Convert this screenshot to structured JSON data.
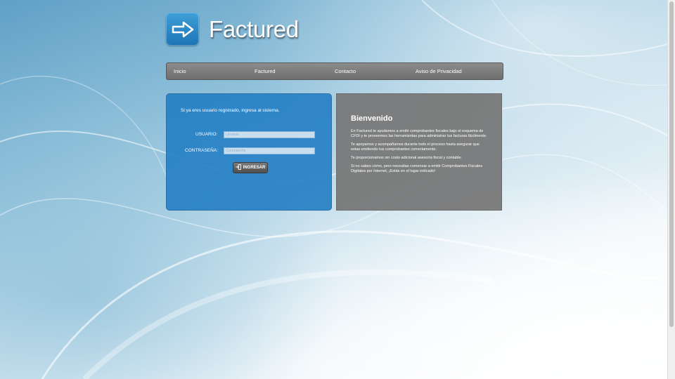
{
  "brand": {
    "name": "Factured",
    "icon": "arrow-right-icon",
    "icon_color": "#2a86c8"
  },
  "nav": {
    "items": [
      "Inicio",
      "Factured",
      "Contacto",
      "Aviso de Privacidad"
    ]
  },
  "login": {
    "message": "Si ya eres usuario registrado, ingresa al sistema.",
    "user_label": "USUARIO:",
    "user_placeholder": "Usuario",
    "password_label": "CONTRASEÑA:",
    "password_placeholder": "Contraseña",
    "submit_label": "INGRESAR",
    "submit_icon": "login-icon",
    "panel_color": "#2680c4"
  },
  "welcome": {
    "title": "Bienvenido",
    "paragraphs": [
      "En Factured te ayudamos a emitir comprobantes fiscales bajo el esquema de CFDI y te proveemos las herramientas para administrar tus facturas fácilmente.",
      "Te apoyamos y acompañamos durante todo el proceso hasta asegurar que estas emitiendo tus comprobantes correctamente.",
      "Te proporcionamos sin costo adicional asesoría fiscal y contable.",
      "Si no sabes cómo, pero necesitas comenzar a emitir Comprobantes Fiscales Digitales por Internet, ¡Estás en el lugar indicado!"
    ],
    "panel_color": "#787878"
  }
}
